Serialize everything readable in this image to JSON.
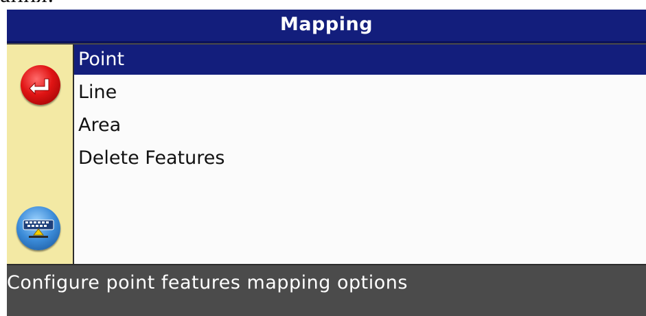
{
  "page_fragment_text": "ания:",
  "window": {
    "title": "Mapping"
  },
  "sidebar": {
    "back_icon": "back-arrow-icon",
    "keyboard_icon": "keyboard-icon"
  },
  "menu": {
    "items": [
      {
        "label": "Point",
        "selected": true
      },
      {
        "label": "Line",
        "selected": false
      },
      {
        "label": "Area",
        "selected": false
      },
      {
        "label": "Delete Features",
        "selected": false
      }
    ]
  },
  "status": {
    "text": "Configure point features mapping options"
  },
  "colors": {
    "title_bar": "#131e7c",
    "selection": "#131e7c",
    "sidebar": "#f3e9a4",
    "status_bar": "#4b4b4b",
    "back_button": "#e01414",
    "keyboard_button": "#3b8bd8"
  }
}
